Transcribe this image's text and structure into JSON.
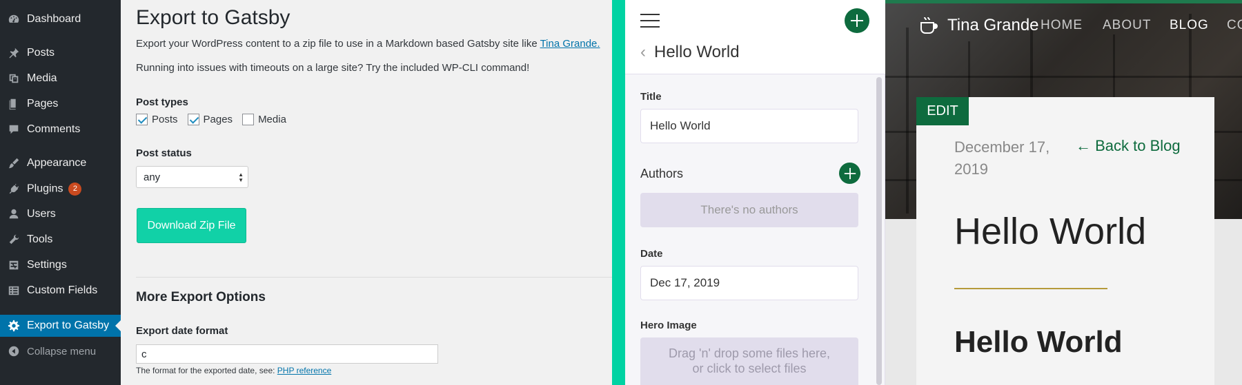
{
  "wp_sidebar": {
    "items": [
      {
        "label": "Dashboard",
        "icon": "dashboard-icon"
      },
      {
        "label": "Posts",
        "icon": "pin-icon"
      },
      {
        "label": "Media",
        "icon": "media-icon"
      },
      {
        "label": "Pages",
        "icon": "pages-icon"
      },
      {
        "label": "Comments",
        "icon": "comments-icon"
      },
      {
        "label": "Appearance",
        "icon": "brush-icon"
      },
      {
        "label": "Plugins",
        "icon": "plugin-icon",
        "badge": "2"
      },
      {
        "label": "Users",
        "icon": "users-icon"
      },
      {
        "label": "Tools",
        "icon": "wrench-icon"
      },
      {
        "label": "Settings",
        "icon": "settings-icon"
      },
      {
        "label": "Custom Fields",
        "icon": "table-icon"
      },
      {
        "label": "Export to Gatsby",
        "icon": "gear-icon",
        "active": true
      },
      {
        "label": "Collapse menu",
        "icon": "collapse-icon"
      }
    ]
  },
  "wp_main": {
    "title": "Export to Gatsby",
    "intro_text": "Export your WordPress content to a zip file to use in a Markdown based Gatsby site like ",
    "intro_link": "Tina Grande.",
    "timeout_text": "Running into issues with timeouts on a large site? Try the included WP-CLI command!",
    "post_types_label": "Post types",
    "post_types": [
      {
        "label": "Posts",
        "checked": true
      },
      {
        "label": "Pages",
        "checked": true
      },
      {
        "label": "Media",
        "checked": false
      }
    ],
    "post_status_label": "Post status",
    "post_status_value": "any",
    "download_button": "Download Zip File",
    "more_options_title": "More Export Options",
    "date_format_label": "Export date format",
    "date_format_value": "c",
    "date_format_help": "The format for the exported date, see: ",
    "date_format_help_link": "PHP reference"
  },
  "tina": {
    "back_title": "Hello World",
    "title_label": "Title",
    "title_value": "Hello World",
    "authors_label": "Authors",
    "authors_empty": "There's no authors",
    "date_label": "Date",
    "date_value": "Dec 17, 2019",
    "hero_label": "Hero Image",
    "hero_drop_line1": "Drag 'n' drop some files here,",
    "hero_drop_line2": "or click to select files"
  },
  "blog": {
    "brand": "Tina Grande",
    "nav": [
      "HOME",
      "ABOUT",
      "BLOG",
      "CO"
    ],
    "active_nav": "BLOG",
    "edit_label": "EDIT",
    "post_date": "December 17, 2019",
    "back_link": "← Back to Blog",
    "post_title": "Hello World",
    "post_heading": "Hello World"
  },
  "colors": {
    "wp_sidebar_bg": "#23282d",
    "wp_active": "#0073aa",
    "teal_accent": "#00d3a3",
    "tina_green": "#0e6b3e",
    "gold_line": "#b59a3a"
  }
}
